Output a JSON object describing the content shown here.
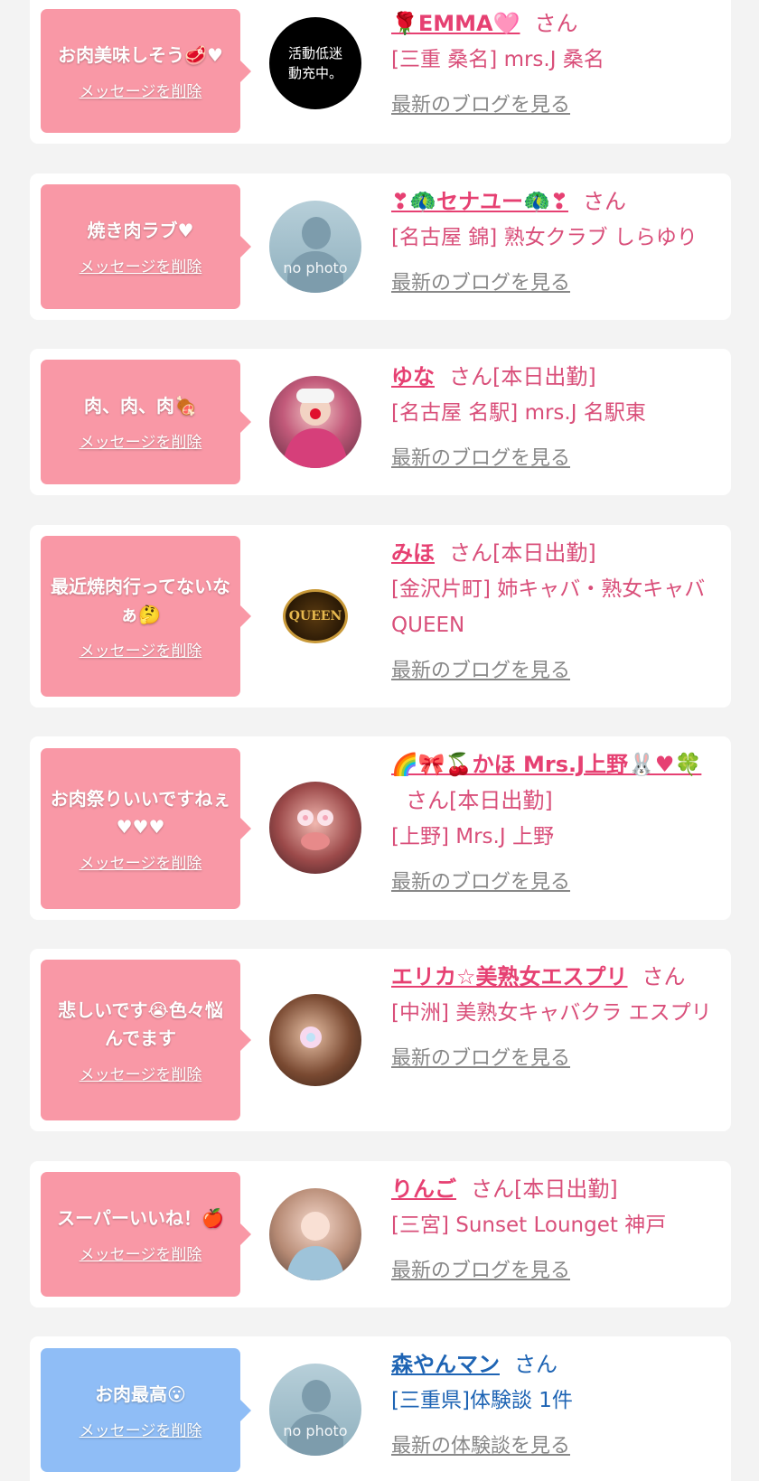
{
  "delete_label": "メッセージを削除",
  "colors": {
    "pink_bubble": "#f998a6",
    "blue_bubble": "#8fbdf6",
    "name_pink": "#e64072",
    "name_blue": "#1e64b4"
  },
  "items": [
    {
      "message": "お肉美味しそう🥩♥",
      "avatar_text": "活動低迷動充中。",
      "name": "🌹EMMA🩷",
      "san": "さん",
      "location": "[三重 桑名] mrs.J 桑名",
      "link": "最新のブログを見る"
    },
    {
      "message": "焼き肉ラブ♥",
      "avatar_text": "no photo",
      "name": "❣🦚セナユー🦚❣",
      "san": "さん",
      "location": "[名古屋 錦] 熟女クラブ しらゆり",
      "link": "最新のブログを見る"
    },
    {
      "message": "肉、肉、肉🍖",
      "name": "ゆな",
      "san": "さん[本日出勤]",
      "location": "[名古屋 名駅] mrs.J 名駅東",
      "link": "最新のブログを見る"
    },
    {
      "message": "最近焼肉行ってないなぁ🤔",
      "avatar_text": "QUEEN",
      "name": "みほ",
      "san": "さん[本日出勤]",
      "location": "[金沢片町] 姉キャバ・熟女キャバ QUEEN",
      "link": "最新のブログを見る"
    },
    {
      "message": "お肉祭りいいですねぇ♥♥♥",
      "name": "🌈🎀🍒かほ Mrs.J上野🐰♥🍀",
      "san": "さん[本日出勤]",
      "location": "[上野] Mrs.J 上野",
      "link": "最新のブログを見る"
    },
    {
      "message": "悲しいです😭色々悩んでます",
      "name": "エリカ☆美熟女エスプリ",
      "san": "さん",
      "location": "[中洲] 美熟女キャバクラ エスプリ",
      "link": "最新のブログを見る"
    },
    {
      "message": "スーパーいいね！🍎",
      "name": "りんご",
      "san": "さん[本日出勤]",
      "location": "[三宮] Sunset Lounget 神戸",
      "link": "最新のブログを見る"
    },
    {
      "message": "お肉最高😮",
      "avatar_text": "no photo",
      "name": "森やんマン",
      "san": "さん",
      "location": "[三重県]体験談 1件",
      "link": "最新の体験談を見る"
    }
  ]
}
